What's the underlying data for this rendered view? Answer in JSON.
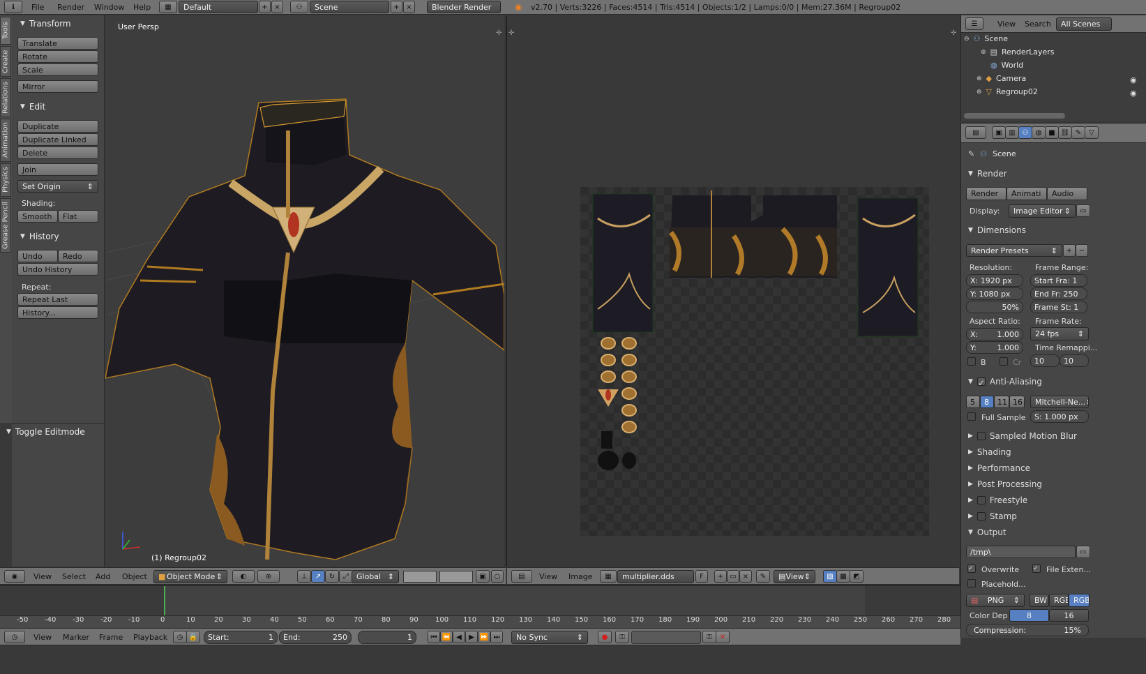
{
  "topbar": {
    "menu": [
      "File",
      "Render",
      "Window",
      "Help"
    ],
    "layout": "Default",
    "scene": "Scene",
    "engine": "Blender Render",
    "stats": "v2.70 | Verts:3226 | Faces:4514 | Tris:4514 | Objects:1/2 | Lamps:0/0 | Mem:27.36M | Regroup02"
  },
  "toolshelf": {
    "tabs": [
      "Tools",
      "Create",
      "Relations",
      "Animation",
      "Physics",
      "Grease Pencil"
    ],
    "transform": {
      "title": "Transform",
      "buttons": [
        "Translate",
        "Rotate",
        "Scale",
        "Mirror"
      ]
    },
    "edit": {
      "title": "Edit",
      "buttons": [
        "Duplicate",
        "Duplicate Linked",
        "Delete",
        "Join"
      ],
      "set_origin": "Set Origin",
      "shading_label": "Shading:",
      "smooth": "Smooth",
      "flat": "Flat"
    },
    "history": {
      "title": "History",
      "undo": "Undo",
      "redo": "Redo",
      "undo_history": "Undo History",
      "repeat_label": "Repeat:",
      "repeat_last": "Repeat Last",
      "history_btn": "History..."
    },
    "operator": "Toggle Editmode"
  },
  "viewport": {
    "label": "User Persp",
    "object": "(1) Regroup02",
    "menu": [
      "View",
      "Select",
      "Add",
      "Object"
    ],
    "mode": "Object Mode",
    "orientation": "Global"
  },
  "image_editor": {
    "menu": [
      "View",
      "Image"
    ],
    "image": "multiplier.dds",
    "f": "F",
    "view": "View"
  },
  "outliner": {
    "menu": [
      "View",
      "Search",
      "All Scenes"
    ],
    "items": [
      "Scene",
      "RenderLayers",
      "World",
      "Camera",
      "Regroup02"
    ]
  },
  "properties": {
    "context": "Scene",
    "render_title": "Render",
    "render_btns": [
      "Render",
      "Animati",
      "Audio"
    ],
    "display_label": "Display:",
    "display_val": "Image Editor",
    "dimensions": "Dimensions",
    "presets": "Render Presets",
    "resolution_label": "Resolution:",
    "res_x": "X: 1920 px",
    "res_y": "Y: 1080 px",
    "res_pct": "50%",
    "frame_range_label": "Frame Range:",
    "start": "Start Fra: 1",
    "end": "End Fr: 250",
    "step": "Frame St: 1",
    "aspect_label": "Aspect Ratio:",
    "asp_x": "X:",
    "asp_x_val": "1.000",
    "asp_y": "Y:",
    "asp_y_val": "1.000",
    "b": "B",
    "cr": "Cr",
    "framerate_label": "Frame Rate:",
    "fps": "24 fps",
    "remap_label": "Time Remappi...",
    "remap_a": "10",
    "remap_b": "10",
    "aa": "Anti-Aliasing",
    "aa_samples": [
      "5",
      "8",
      "11",
      "16"
    ],
    "aa_filter": "Mitchell-Ne...",
    "full_sample": "Full Sample",
    "filter_size": "S: 1.000 px",
    "sections": [
      "Sampled Motion Blur",
      "Shading",
      "Performance",
      "Post Processing",
      "Freestyle",
      "Stamp"
    ],
    "output": "Output",
    "path": "/tmp\\",
    "overwrite": "Overwrite",
    "file_ext": "File Exten...",
    "placeholders": "Placehold...",
    "format": "PNG",
    "bw": "BW",
    "rgb": "RGB",
    "rgba": "RGB",
    "color_depth": "Color Dep",
    "depth8": "8",
    "depth16": "16",
    "compression": "Compression:",
    "compression_val": "15%"
  },
  "timeline": {
    "ticks": [
      "-50",
      "-40",
      "-30",
      "-20",
      "-10",
      "0",
      "10",
      "20",
      "30",
      "40",
      "50",
      "60",
      "70",
      "80",
      "90",
      "100",
      "110",
      "120",
      "130",
      "140",
      "150",
      "160",
      "170",
      "180",
      "190",
      "200",
      "210",
      "220",
      "230",
      "240",
      "250",
      "260",
      "270",
      "280"
    ],
    "menu": [
      "View",
      "Marker",
      "Frame",
      "Playback"
    ],
    "start": "Start:",
    "start_val": "1",
    "end": "End:",
    "end_val": "250",
    "current": "1",
    "sync": "No Sync"
  }
}
